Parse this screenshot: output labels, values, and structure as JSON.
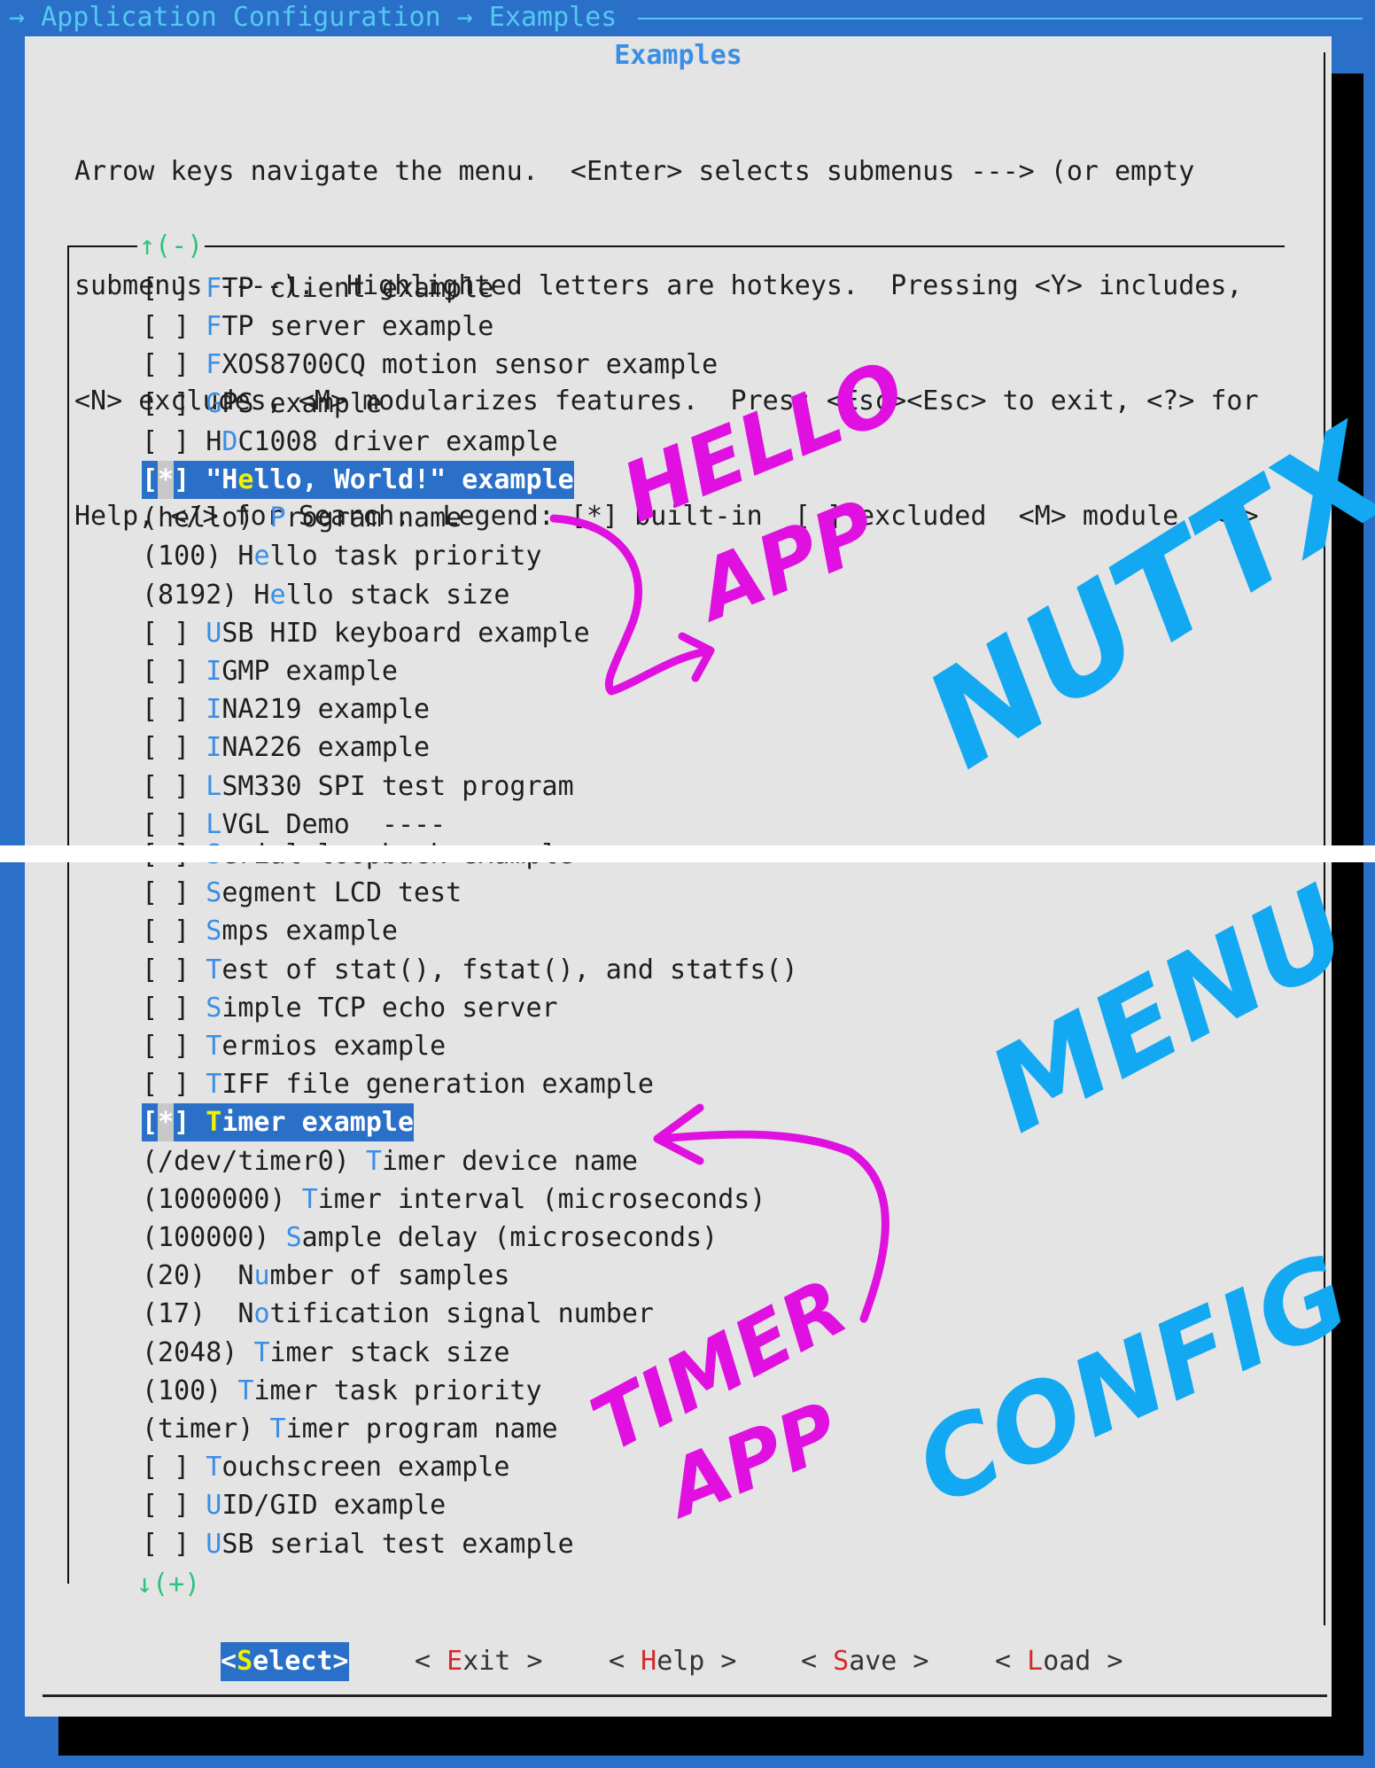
{
  "breadcrumb": "→ Application Configuration → Examples",
  "dialog": {
    "title": "Examples",
    "help_lines": [
      "Arrow keys navigate the menu.  <Enter> selects submenus ---> (or empty",
      "submenus ----).  Highlighted letters are hotkeys.  Pressing <Y> includes,",
      "<N> excludes, <M> modularizes features.  Press <Esc><Esc> to exit, <?> for",
      "Help, </> for Search.  Legend: [*] built-in  [ ] excluded  <M> module  < >"
    ],
    "scroll_up": "↑(-)",
    "scroll_down": "↓(+)"
  },
  "menu_top": [
    {
      "pre": "[ ] ",
      "key": "F",
      "post": "TP client example"
    },
    {
      "pre": "[ ] ",
      "key": "F",
      "post": "TP server example"
    },
    {
      "pre": "[ ] ",
      "key": "F",
      "post": "XOS8700CQ motion sensor example"
    },
    {
      "pre": "[ ] ",
      "key": "G",
      "post": "PS example"
    },
    {
      "pre": "[ ] H",
      "key": "D",
      "post": "C1008 driver example"
    },
    {
      "pre": "[*] \"H",
      "key": "e",
      "post": "llo, World!\" example",
      "selected": true
    },
    {
      "pre": "(hello) ",
      "key": "P",
      "post": "rogram name"
    },
    {
      "pre": "(100) H",
      "key": "e",
      "post": "llo task priority"
    },
    {
      "pre": "(8192) H",
      "key": "e",
      "post": "llo stack size"
    },
    {
      "pre": "[ ] ",
      "key": "U",
      "post": "SB HID keyboard example"
    },
    {
      "pre": "[ ] ",
      "key": "I",
      "post": "GMP example"
    },
    {
      "pre": "[ ] ",
      "key": "I",
      "post": "NA219 example"
    },
    {
      "pre": "[ ] ",
      "key": "I",
      "post": "NA226 example"
    },
    {
      "pre": "[ ] ",
      "key": "L",
      "post": "SM330 SPI test program"
    },
    {
      "pre": "[ ] ",
      "key": "L",
      "post": "VGL Demo  ----"
    }
  ],
  "menu_bottom": [
    {
      "pre": "[ ] ",
      "key": "S",
      "post": "erial loopback example"
    },
    {
      "pre": "[ ] ",
      "key": "S",
      "post": "egment LCD test"
    },
    {
      "pre": "[ ] ",
      "key": "S",
      "post": "mps example"
    },
    {
      "pre": "[ ] ",
      "key": "T",
      "post": "est of stat(), fstat(), and statfs()"
    },
    {
      "pre": "[ ] ",
      "key": "S",
      "post": "imple TCP echo server"
    },
    {
      "pre": "[ ] ",
      "key": "T",
      "post": "ermios example"
    },
    {
      "pre": "[ ] ",
      "key": "T",
      "post": "IFF file generation example"
    },
    {
      "pre": "[*] ",
      "key": "T",
      "post": "imer example",
      "selected": true
    },
    {
      "pre": "(/dev/timer0) ",
      "key": "T",
      "post": "imer device name"
    },
    {
      "pre": "(1000000) ",
      "key": "T",
      "post": "imer interval (microseconds)"
    },
    {
      "pre": "(100000) ",
      "key": "S",
      "post": "ample delay (microseconds)"
    },
    {
      "pre": "(20)  N",
      "key": "u",
      "post": "mber of samples"
    },
    {
      "pre": "(17)  N",
      "key": "o",
      "post": "tification signal number"
    },
    {
      "pre": "(2048) ",
      "key": "T",
      "post": "imer stack size"
    },
    {
      "pre": "(100) ",
      "key": "T",
      "post": "imer task priority"
    },
    {
      "pre": "(timer) ",
      "key": "T",
      "post": "imer program name"
    },
    {
      "pre": "[ ] ",
      "key": "T",
      "post": "ouchscreen example"
    },
    {
      "pre": "[ ] ",
      "key": "U",
      "post": "ID/GID example"
    },
    {
      "pre": "[ ] ",
      "key": "U",
      "post": "SB serial test example"
    }
  ],
  "buttons": [
    {
      "id": "select",
      "pre": "<",
      "key": "S",
      "post": "elect>",
      "selected": true
    },
    {
      "id": "exit",
      "pre": "< ",
      "key": "E",
      "post": "xit >"
    },
    {
      "id": "help",
      "pre": "< ",
      "key": "H",
      "post": "elp >"
    },
    {
      "id": "save",
      "pre": "< ",
      "key": "S",
      "post": "ave >"
    },
    {
      "id": "load",
      "pre": "< ",
      "key": "L",
      "post": "oad >"
    }
  ],
  "annotations": {
    "hello_1": "HELLO",
    "hello_2": "APP",
    "timer_1": "TIMER",
    "timer_2": "APP",
    "nuttx": "NUTTX",
    "menu": "MENU",
    "config": "CONFIG"
  },
  "colors": {
    "background": "#2a6fc8",
    "dialog": "#e4e4e4",
    "hotkey": "#3a8ee6",
    "button_hotkey": "#d42a2a",
    "selected_hotkey": "#f2f200",
    "scroll_indicator": "#2ec27e",
    "annotation_magenta": "#e010e0",
    "annotation_cyan": "#12a9f2"
  }
}
